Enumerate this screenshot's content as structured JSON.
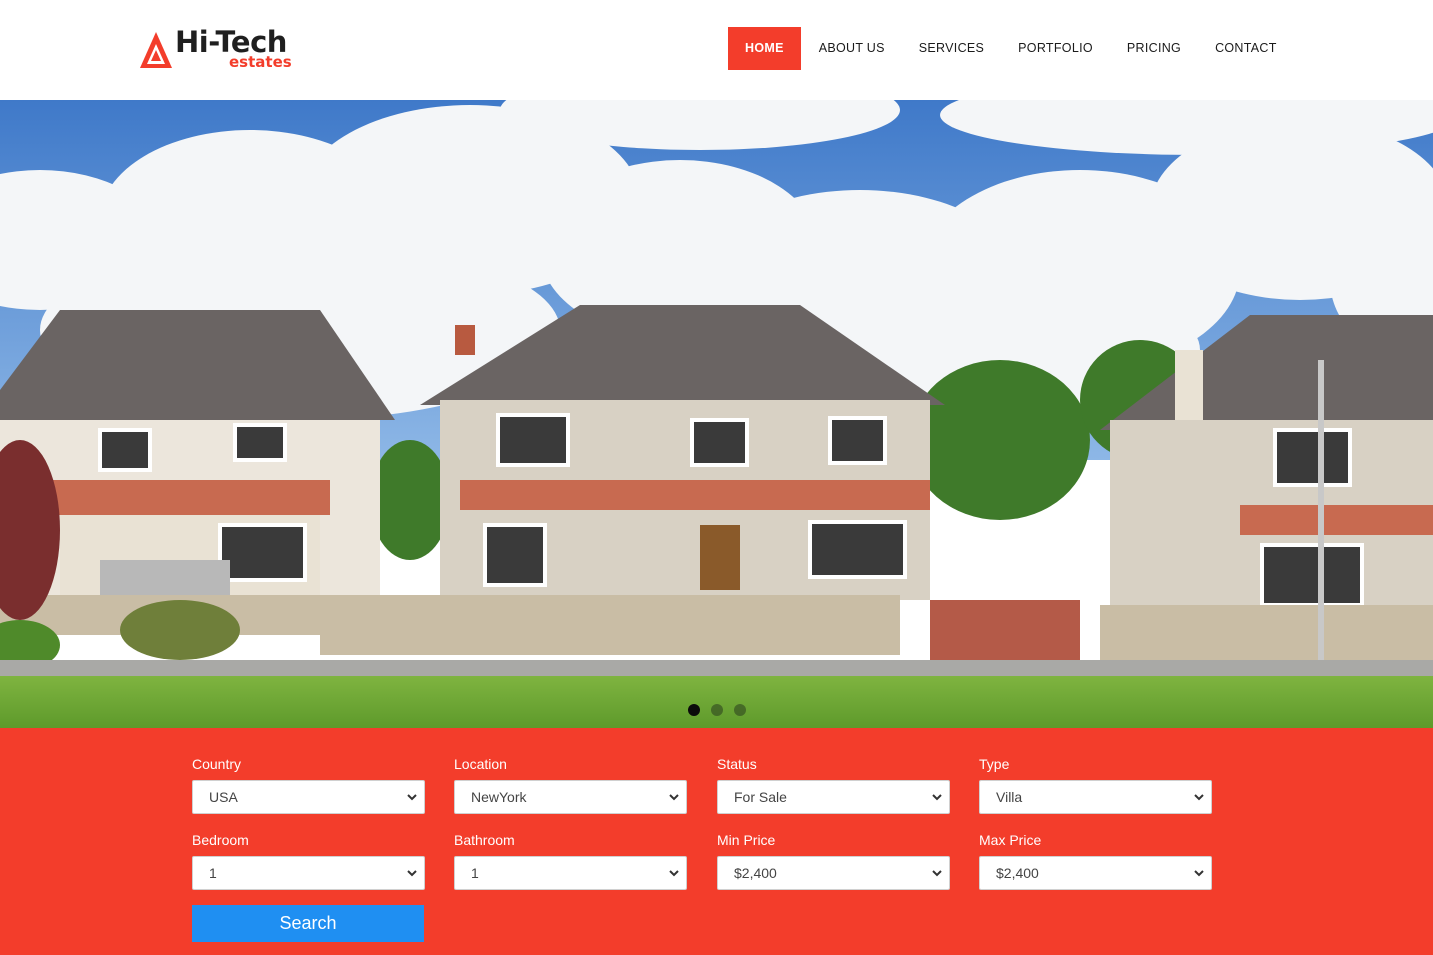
{
  "brand": {
    "name": "Hi-Tech",
    "sub": "estates",
    "accent": "#f33d2b",
    "icon": "triangle-logo-icon"
  },
  "nav": {
    "items": [
      {
        "label": "HOME",
        "active": true
      },
      {
        "label": "ABOUT US"
      },
      {
        "label": "SERVICES"
      },
      {
        "label": "PORTFOLIO"
      },
      {
        "label": "PRICING"
      },
      {
        "label": "CONTACT"
      }
    ]
  },
  "hero": {
    "image": "suburban-houses-photo",
    "slides": 3,
    "active_slide": 1
  },
  "search": {
    "background": "#f33d2b",
    "button_color": "#1f8ff2",
    "fields": [
      {
        "label": "Country",
        "value": "USA"
      },
      {
        "label": "Location",
        "value": "NewYork"
      },
      {
        "label": "Status",
        "value": "For Sale"
      },
      {
        "label": "Type",
        "value": "Villa"
      },
      {
        "label": "Bedroom",
        "value": "1"
      },
      {
        "label": "Bathroom",
        "value": "1"
      },
      {
        "label": "Min Price",
        "value": "$2,400"
      },
      {
        "label": "Max Price",
        "value": "$2,400"
      }
    ],
    "button_label": "Search"
  }
}
